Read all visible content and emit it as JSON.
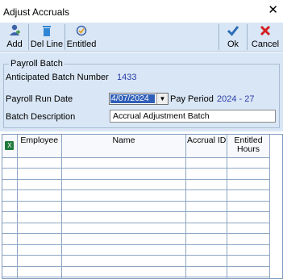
{
  "window": {
    "title": "Adjust Accruals",
    "close_label": "✕"
  },
  "toolbar": {
    "add_label": "Add",
    "delline_label": "Del Line",
    "entitled_label": "Entitled",
    "ok_label": "Ok",
    "cancel_label": "Cancel"
  },
  "payroll_batch": {
    "legend": "Payroll Batch",
    "anticipated_label": "Anticipated Batch Number",
    "anticipated_value": "1433",
    "run_date_label": "Payroll Run Date",
    "run_date_value": "4/07/2024",
    "pay_period_label": "Pay Period",
    "pay_period_value": "2024 - 27",
    "description_label": "Batch Description",
    "description_value": "Accrual Adjustment Batch"
  },
  "grid": {
    "columns": [
      "Employee",
      "Name",
      "Accrual ID",
      "Entitled Hours"
    ],
    "row_count": 12
  },
  "colors": {
    "toolbar_bg": "#d9e6f5",
    "value_blue": "#2a3ea8",
    "ok_blue": "#2f6db8",
    "cancel_red": "#d42020"
  }
}
